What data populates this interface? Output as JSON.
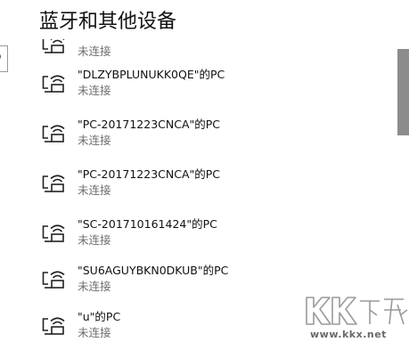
{
  "page": {
    "title": "蓝牙和其他设备"
  },
  "devices": [
    {
      "name": "",
      "status": "未连接",
      "icon": "wireless-display-icon"
    },
    {
      "name": "\"DLZYBPLUNUKK0QE\"的PC",
      "status": "未连接",
      "icon": "wireless-display-icon"
    },
    {
      "name": "\"PC-20171223CNCA\"的PC",
      "status": "未连接",
      "icon": "wireless-display-icon"
    },
    {
      "name": "\"PC-20171223CNCA\"的PC",
      "status": "未连接",
      "icon": "wireless-display-icon"
    },
    {
      "name": "\"SC-201710161424\"的PC",
      "status": "未连接",
      "icon": "wireless-display-icon"
    },
    {
      "name": "\"SU6AGUYBKN0DKUB\"的PC",
      "status": "未连接",
      "icon": "wireless-display-icon"
    },
    {
      "name": "\"u\"的PC",
      "status": "未连接",
      "icon": "wireless-display-icon"
    }
  ],
  "watermark": {
    "text": "www.kkx.net",
    "logo": "KK下载"
  },
  "colors": {
    "background": "#ffffff",
    "text_primary": "#111111",
    "text_secondary": "#6e6e6e",
    "scrollbar": "#8c8c8c"
  }
}
